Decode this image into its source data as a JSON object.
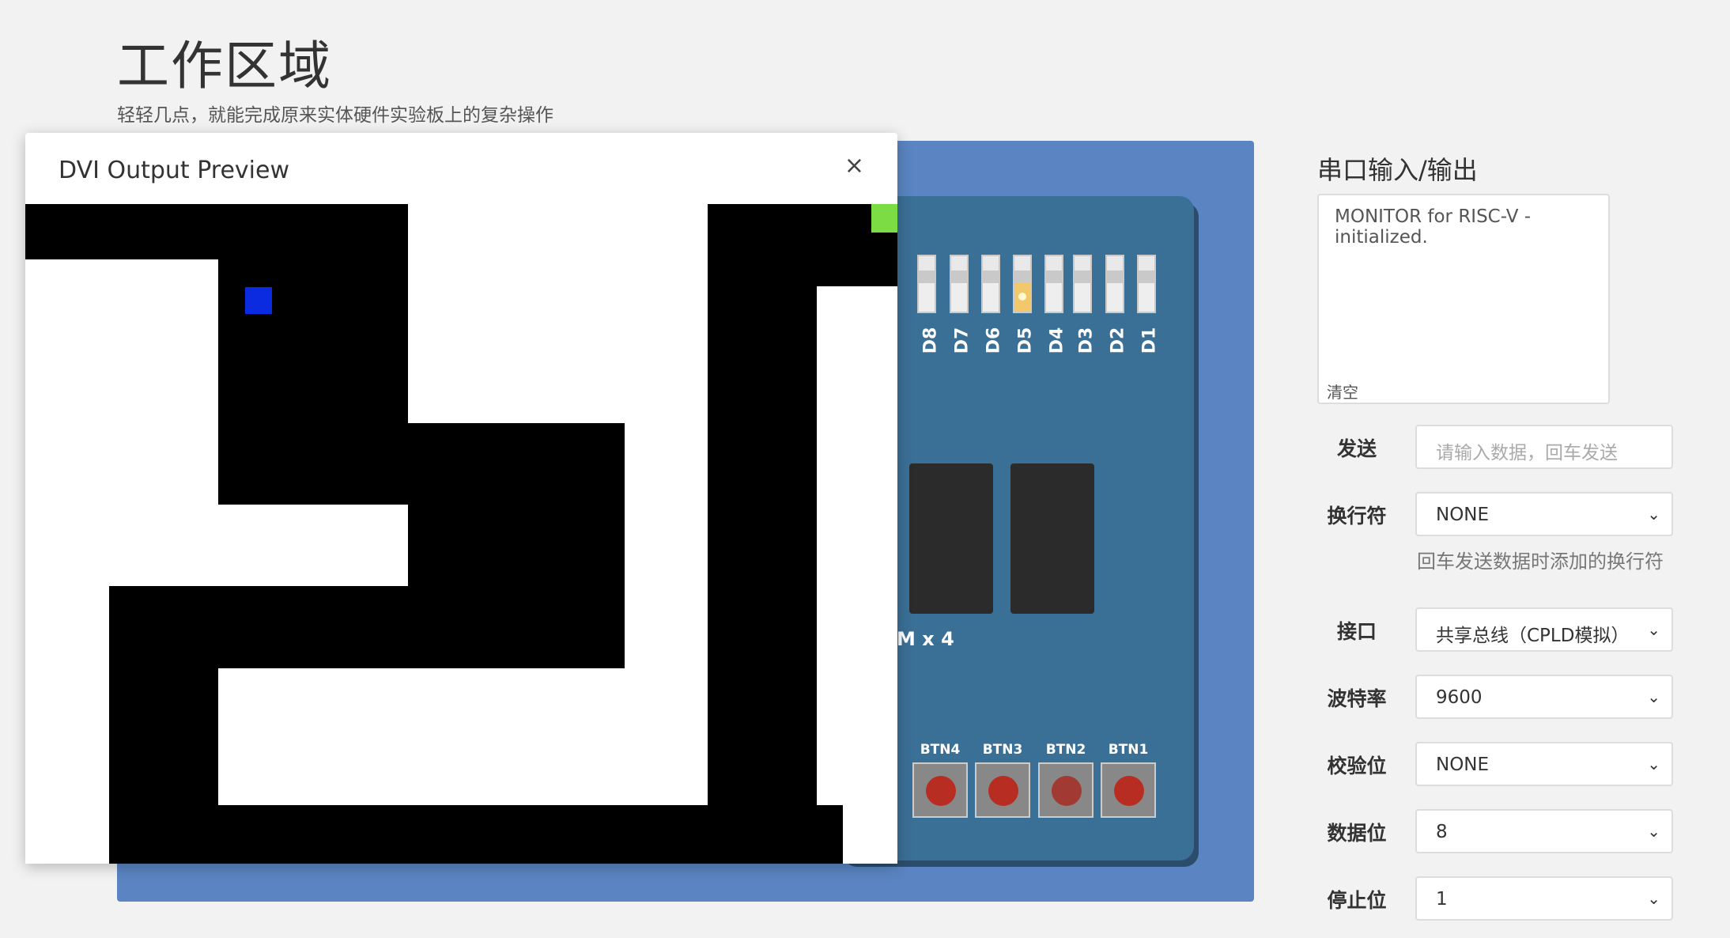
{
  "page": {
    "title": "工作区域",
    "subtitle": "轻轻几点，就能完成原来实体硬件实验板上的复杂操作"
  },
  "board": {
    "leds": [
      "D8",
      "D7",
      "D6",
      "D5",
      "D4",
      "D3",
      "D2",
      "D1"
    ],
    "leds_on": [
      "D5"
    ],
    "chip_label": "M x 4",
    "buttons": [
      "BTN4",
      "BTN3",
      "BTN2",
      "BTN1"
    ]
  },
  "modal": {
    "title": "DVI Output Preview",
    "close": "×"
  },
  "serial": {
    "title": "串口输入/输出",
    "output": "MONITOR for RISC-V - initialized.",
    "clear": "清空",
    "send_label": "发送",
    "send_placeholder": "请输入数据，回车发送",
    "newline_label": "换行符",
    "newline_value": "NONE",
    "newline_hint": "回车发送数据时添加的换行符",
    "port_label": "接口",
    "port_value": "共享总线（CPLD模拟）",
    "baud_label": "波特率",
    "baud_value": "9600",
    "parity_label": "校验位",
    "parity_value": "NONE",
    "databits_label": "数据位",
    "databits_value": "8",
    "stopbits_label": "停止位",
    "stopbits_value": "1"
  },
  "colors": {
    "board_bg": "#5a85c2",
    "board": "#3a6f96",
    "player": "#0b2be0",
    "goal": "#7cdc44"
  }
}
